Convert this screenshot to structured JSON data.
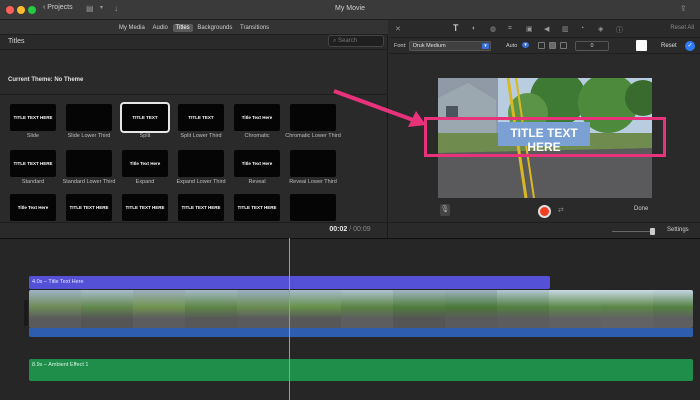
{
  "titlebar": {
    "back_label": "Projects",
    "title": "My Movie",
    "icons": [
      "clip-adjust-icon",
      "download-icon",
      "share-icon"
    ]
  },
  "browser": {
    "tabs": [
      {
        "label": "My Media",
        "active": false
      },
      {
        "label": "Audio",
        "active": false
      },
      {
        "label": "Titles",
        "active": true
      },
      {
        "label": "Backgrounds",
        "active": false
      },
      {
        "label": "Transitions",
        "active": false
      }
    ],
    "section_title": "Titles",
    "search_placeholder": "Search",
    "theme_label": "Current Theme: No Theme",
    "tiles": [
      {
        "label": "Slide",
        "preview": "TITLE TEXT HERE",
        "selected": false
      },
      {
        "label": "Slide Lower Third",
        "preview": "",
        "selected": false
      },
      {
        "label": "Split",
        "preview": "TITLE TEXT",
        "selected": true
      },
      {
        "label": "Split Lower Third",
        "preview": "TITLE TEXT",
        "selected": false
      },
      {
        "label": "Chromatic",
        "preview": "Title Text Here",
        "selected": false
      },
      {
        "label": "Chromatic Lower Third",
        "preview": "",
        "selected": false
      },
      {
        "label": "Standard",
        "preview": "TITLE TEXT HERE",
        "selected": false
      },
      {
        "label": "Standard Lower Third",
        "preview": "",
        "selected": false
      },
      {
        "label": "Expand",
        "preview": "Title Text Here",
        "selected": false
      },
      {
        "label": "Expand Lower Third",
        "preview": "",
        "selected": false
      },
      {
        "label": "Reveal",
        "preview": "Title Text Here",
        "selected": false
      },
      {
        "label": "Reveal Lower Third",
        "preview": "",
        "selected": false
      },
      {
        "label": "",
        "preview": "Title Text Here",
        "selected": false
      },
      {
        "label": "",
        "preview": "TITLE TEXT HERE",
        "selected": false
      },
      {
        "label": "",
        "preview": "TITLE TEXT HERE",
        "selected": false
      },
      {
        "label": "",
        "preview": "TITLE TEXT HERE",
        "selected": false
      },
      {
        "label": "",
        "preview": "TITLE TEXT HERE",
        "selected": false
      },
      {
        "label": "",
        "preview": "",
        "selected": false
      }
    ]
  },
  "inspector": {
    "reset_all": "Reset All",
    "font_label": "Font:",
    "font_value": "Druk Medium",
    "auto_label": "Auto",
    "size_value": "0",
    "reset_label": "Reset",
    "confirm_icon": "checkmark-icon",
    "accent_color": "#2f7cf6"
  },
  "viewer": {
    "overlay_title": "TITLE TEXT HERE",
    "done_label": "Done",
    "highlight_color": "#e8337a"
  },
  "transport": {
    "current_time": "00:02",
    "separator": "/",
    "total_time": "00:09",
    "settings_label": "Settings"
  },
  "timeline": {
    "title_clip_label": "4.0s – Title Text Here",
    "audio_clip_label": "8.9s – Ambient Effect 1",
    "title_clip_color": "#5451d6",
    "audio_clip_color": "#1e8e4a"
  }
}
